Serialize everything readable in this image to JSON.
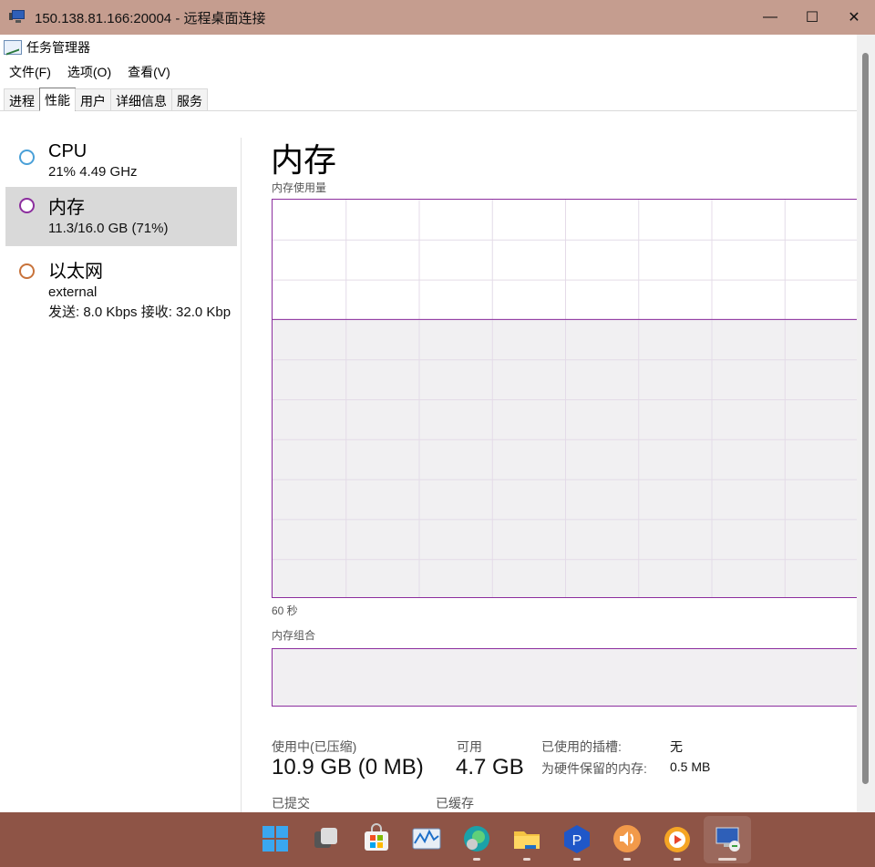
{
  "window": {
    "title": "150.138.81.166:20004 - 远程桌面连接",
    "minimize": "—",
    "maximize": "☐",
    "close": "✕"
  },
  "app": {
    "title": "任务管理器",
    "menus": [
      "文件(F)",
      "选项(O)",
      "查看(V)"
    ],
    "tabs": [
      "进程",
      "性能",
      "用户",
      "详细信息",
      "服务"
    ],
    "active_tab": "性能"
  },
  "resources": [
    {
      "name": "CPU",
      "line1": "21%  4.49 GHz",
      "line2": "",
      "color": "#4aa0d8",
      "selected": false
    },
    {
      "name": "内存",
      "line1": "11.3/16.0 GB (71%)",
      "line2": "",
      "color": "#8c2e9e",
      "selected": true
    },
    {
      "name": "以太网",
      "line1": "external",
      "line2": "发送: 8.0 Kbps  接收: 32.0 Kbp",
      "color": "#c8733b",
      "selected": false
    }
  ],
  "memory": {
    "heading": "内存",
    "usage_label": "内存使用量",
    "time_label": "60 秒",
    "composition_label": "内存组合",
    "in_use_label": "使用中(已压缩)",
    "in_use_value": "10.9 GB (0 MB)",
    "available_label": "可用",
    "available_value": "4.7 GB",
    "slots_label": "已使用的插槽:",
    "slots_value": "无",
    "reserved_label": "为硬件保留的内存:",
    "reserved_value": "0.5 MB",
    "committed_label": "已提交",
    "cached_label": "已缓存",
    "graph_color": "#8c2e9e",
    "usage_percent": 70
  },
  "taskbar": {
    "icons": [
      "windows-start-icon",
      "task-view-icon",
      "store-icon",
      "resource-monitor-icon",
      "edge-icon",
      "file-explorer-icon",
      "p-app-icon",
      "volume-app-icon",
      "video-app-icon",
      "remote-desktop-icon"
    ]
  }
}
